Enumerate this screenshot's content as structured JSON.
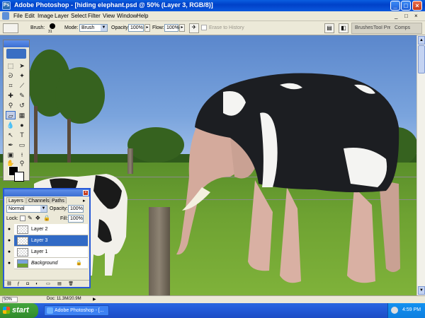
{
  "window": {
    "title": "Adobe Photoshop - [hiding elephant.psd @ 50% (Layer 3, RGB/8)]",
    "min": "_",
    "max": "□",
    "close": "×"
  },
  "menu": {
    "items": [
      "File",
      "Edit",
      "Image",
      "Layer",
      "Select",
      "Filter",
      "View",
      "Window",
      "Help"
    ],
    "doc_min": "_",
    "doc_max": "□",
    "doc_close": "×"
  },
  "options": {
    "brush_label": "Brush:",
    "brush_size": "31",
    "mode_label": "Mode:",
    "mode_value": "Brush",
    "opacity_label": "Opacity:",
    "opacity_value": "100%",
    "flow_label": "Flow:",
    "flow_value": "100%",
    "erase_history": "Erase to History",
    "well_tabs": [
      "Brushes",
      "Tool Presets",
      "Comps"
    ]
  },
  "layers_palette": {
    "tabs": [
      "Layers",
      "Channels",
      "Paths"
    ],
    "blend_mode": "Normal",
    "opacity_label": "Opacity:",
    "opacity_value": "100%",
    "lock_label": "Lock:",
    "fill_label": "Fill:",
    "fill_value": "100%",
    "layers": [
      {
        "name": "Layer 2",
        "selected": false
      },
      {
        "name": "Layer 3",
        "selected": true
      },
      {
        "name": "Layer 1",
        "selected": false
      },
      {
        "name": "Background",
        "selected": false
      }
    ]
  },
  "status": {
    "zoom": "50%",
    "doc": "Doc: 11.3M/20.9M",
    "arrow": "▶"
  },
  "taskbar": {
    "start": "start",
    "task_label": "Adobe Photoshop - [...",
    "clock": "4:59 PM"
  }
}
